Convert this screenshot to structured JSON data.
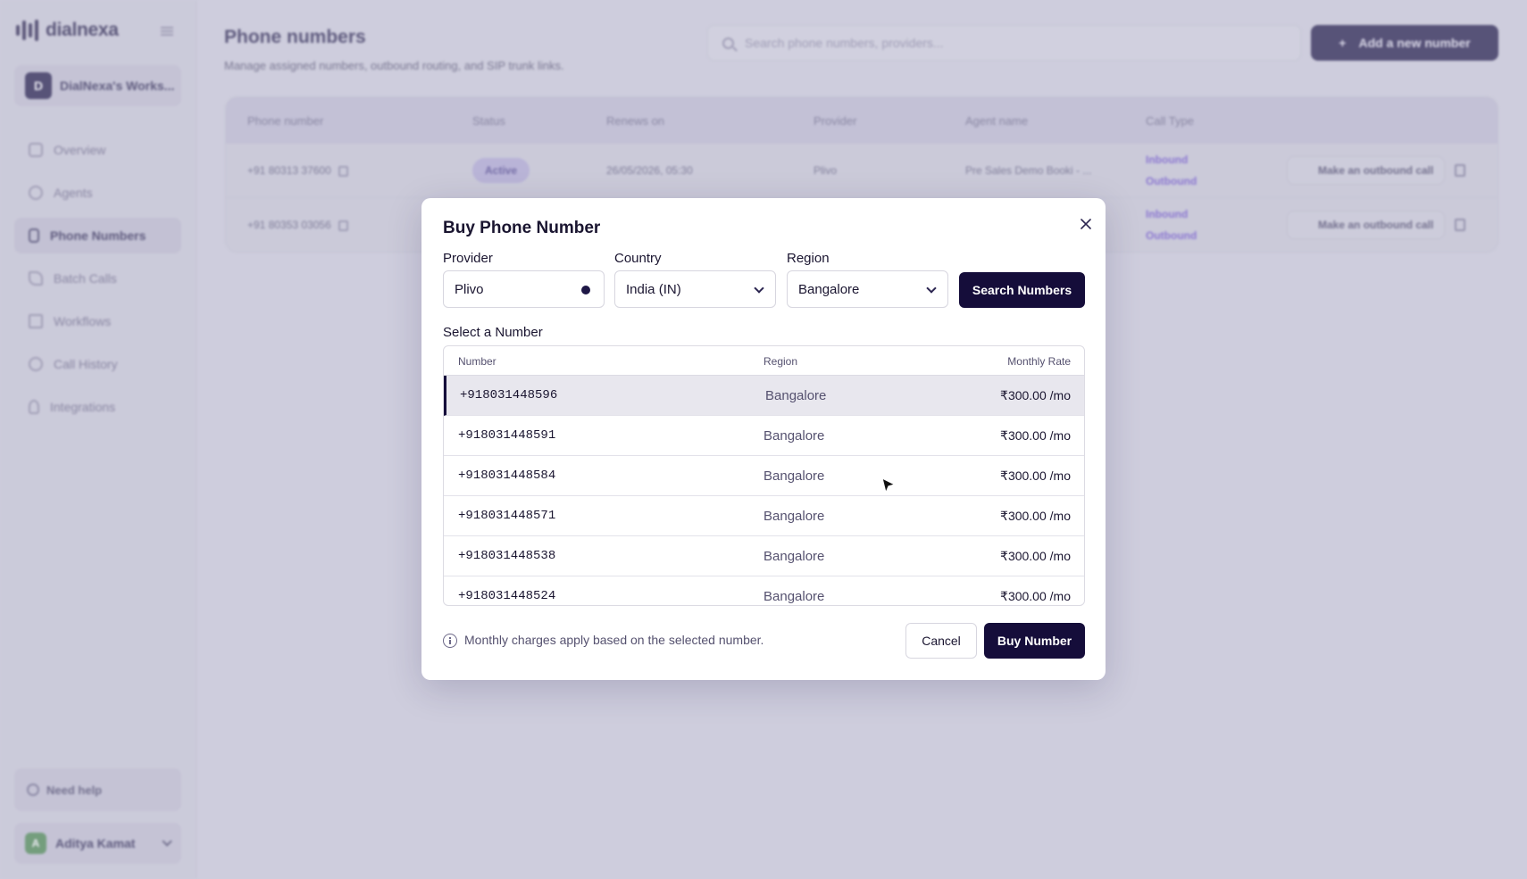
{
  "app": {
    "brand": "dialnexa",
    "workspace_initial": "D",
    "workspace_name": "DialNexa's Works...",
    "nav": [
      {
        "label": "Overview",
        "icon": "dashboard-icon"
      },
      {
        "label": "Agents",
        "icon": "agent-icon"
      },
      {
        "label": "Phone Numbers",
        "icon": "phone-icon",
        "active": true
      },
      {
        "label": "Batch Calls",
        "icon": "batch-call-icon"
      },
      {
        "label": "Workflows",
        "icon": "workflow-icon"
      },
      {
        "label": "Call History",
        "icon": "history-icon"
      },
      {
        "label": "Integrations",
        "icon": "integration-icon"
      }
    ],
    "help_label": "Need help",
    "user_initial": "A",
    "user_name": "Aditya Kamat"
  },
  "page": {
    "title": "Phone numbers",
    "subtitle": "Manage assigned numbers, outbound routing, and SIP trunk links.",
    "search_placeholder": "Search phone numbers, providers...",
    "add_button": "Add a new number",
    "table": {
      "headers": [
        "Phone number",
        "Status",
        "Renews on",
        "Provider",
        "Agent name",
        "Call Type"
      ],
      "rows": [
        {
          "number": "+91 80313 37600",
          "status": "Active",
          "renews": "26/05/2026, 05:30",
          "provider": "Plivo",
          "agent": "Pre Sales Demo Booki - ...",
          "inbound": "Inbound",
          "outbound": "Outbound",
          "action": "Make an outbound call"
        },
        {
          "number": "+91 80353 03056",
          "status": "",
          "renews": "",
          "provider": "",
          "agent": "",
          "inbound": "Inbound",
          "outbound": "Outbound",
          "action": "Make an outbound call"
        }
      ]
    }
  },
  "modal": {
    "title": "Buy Phone Number",
    "provider_label": "Provider",
    "provider_value": "Plivo",
    "country_label": "Country",
    "country_value": "India (IN)",
    "region_label": "Region",
    "region_value": "Bangalore",
    "search_button": "Search Numbers",
    "select_label": "Select a Number",
    "columns": {
      "number": "Number",
      "region": "Region",
      "rate": "Monthly Rate"
    },
    "numbers": [
      {
        "number": "+918031448596",
        "region": "Bangalore",
        "rate": "₹300.00 /mo"
      },
      {
        "number": "+918031448591",
        "region": "Bangalore",
        "rate": "₹300.00 /mo"
      },
      {
        "number": "+918031448584",
        "region": "Bangalore",
        "rate": "₹300.00 /mo"
      },
      {
        "number": "+918031448571",
        "region": "Bangalore",
        "rate": "₹300.00 /mo"
      },
      {
        "number": "+918031448538",
        "region": "Bangalore",
        "rate": "₹300.00 /mo"
      },
      {
        "number": "+918031448524",
        "region": "Bangalore",
        "rate": "₹300.00 /mo"
      }
    ],
    "info_text": "Monthly charges apply based on the selected number.",
    "cancel_button": "Cancel",
    "buy_button": "Buy Number"
  },
  "colors": {
    "primary": "#150d3a",
    "accent": "#6e4fcf",
    "selected_row": "#e8e7ee"
  }
}
